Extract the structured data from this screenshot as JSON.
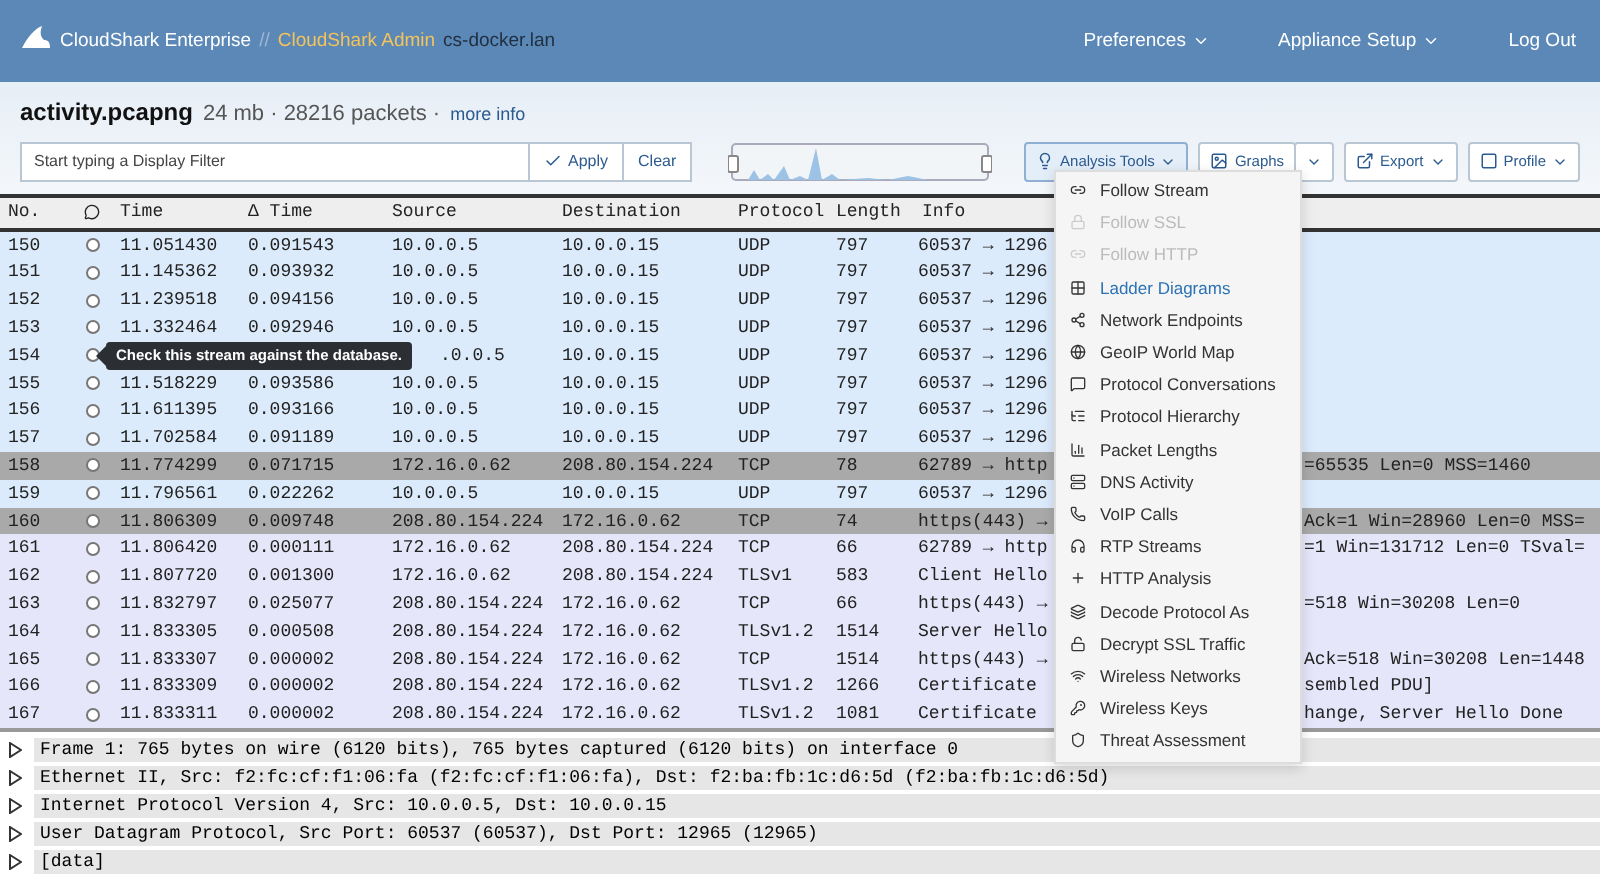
{
  "nav": {
    "brand": "CloudShark Enterprise",
    "separator": "//",
    "admin": "CloudShark Admin",
    "host": "cs-docker.lan",
    "links": [
      {
        "label": "Preferences",
        "dropdown": true
      },
      {
        "label": "Appliance Setup",
        "dropdown": true
      },
      {
        "label": "Log Out",
        "dropdown": false
      }
    ]
  },
  "file": {
    "name": "activity.pcapng",
    "meta": "24 mb · 28216 packets ·",
    "more": "more info"
  },
  "filter": {
    "placeholder": "Start typing a Display Filter",
    "apply": "Apply",
    "clear": "Clear"
  },
  "toolbar": [
    {
      "label": "Analysis Tools",
      "kind": "tools",
      "selected": true
    },
    {
      "label": "Graphs",
      "kind": "split",
      "selected": false
    },
    {
      "label": "Export",
      "kind": "export",
      "selected": false
    },
    {
      "label": "Profile",
      "kind": "profile",
      "selected": false
    }
  ],
  "table": {
    "columns": [
      "No.",
      "Time",
      "Δ Time",
      "Source",
      "Destination",
      "Protocol",
      "Length",
      "Info"
    ],
    "rows": [
      {
        "no": "150",
        "time": "11.051430",
        "delta": "0.091543",
        "source": "10.0.0.5",
        "destination": "10.0.0.15",
        "protocol": "UDP",
        "length": "797",
        "info": "60537 → 1296",
        "color": "#dcebfb"
      },
      {
        "no": "151",
        "time": "11.145362",
        "delta": "0.093932",
        "source": "10.0.0.5",
        "destination": "10.0.0.15",
        "protocol": "UDP",
        "length": "797",
        "info": "60537 → 1296",
        "color": "#dcebfb"
      },
      {
        "no": "152",
        "time": "11.239518",
        "delta": "0.094156",
        "source": "10.0.0.5",
        "destination": "10.0.0.15",
        "protocol": "UDP",
        "length": "797",
        "info": "60537 → 1296",
        "color": "#dcebfb"
      },
      {
        "no": "153",
        "time": "11.332464",
        "delta": "0.092946",
        "source": "10.0.0.5",
        "destination": "10.0.0.15",
        "protocol": "UDP",
        "length": "797",
        "info": "60537 → 1296",
        "color": "#dcebfb"
      },
      {
        "no": "154",
        "tooltip": "Check this stream against the database.",
        "source": ".0.0.5",
        "destination": "10.0.0.15",
        "protocol": "UDP",
        "length": "797",
        "info": "60537 → 1296",
        "color": "#dcebfb"
      },
      {
        "no": "155",
        "time": "11.518229",
        "delta": "0.093586",
        "source": "10.0.0.5",
        "destination": "10.0.0.15",
        "protocol": "UDP",
        "length": "797",
        "info": "60537 → 1296",
        "color": "#dcebfb"
      },
      {
        "no": "156",
        "time": "11.611395",
        "delta": "0.093166",
        "source": "10.0.0.5",
        "destination": "10.0.0.15",
        "protocol": "UDP",
        "length": "797",
        "info": "60537 → 1296",
        "color": "#dcebfb"
      },
      {
        "no": "157",
        "time": "11.702584",
        "delta": "0.091189",
        "source": "10.0.0.5",
        "destination": "10.0.0.15",
        "protocol": "UDP",
        "length": "797",
        "info": "60537 → 1296",
        "color": "#dcebfb"
      },
      {
        "no": "158",
        "time": "11.774299",
        "delta": "0.071715",
        "source": "172.16.0.62",
        "destination": "208.80.154.224",
        "protocol": "TCP",
        "length": "78",
        "info": "62789 → http",
        "info_right": "=65535 Len=0 MSS=1460",
        "color": "#a9a9a9"
      },
      {
        "no": "159",
        "time": "11.796561",
        "delta": "0.022262",
        "source": "10.0.0.5",
        "destination": "10.0.0.15",
        "protocol": "UDP",
        "length": "797",
        "info": "60537 → 1296",
        "color": "#dcebfb"
      },
      {
        "no": "160",
        "time": "11.806309",
        "delta": "0.009748",
        "source": "208.80.154.224",
        "destination": "172.16.0.62",
        "protocol": "TCP",
        "length": "74",
        "info": "https(443) →",
        "info_right": "Ack=1 Win=28960 Len=0 MSS=",
        "color": "#a9a9a9"
      },
      {
        "no": "161",
        "time": "11.806420",
        "delta": "0.000111",
        "source": "172.16.0.62",
        "destination": "208.80.154.224",
        "protocol": "TCP",
        "length": "66",
        "info": "62789 → http",
        "info_right": "=1 Win=131712 Len=0 TSval=",
        "color": "#e6e6fa"
      },
      {
        "no": "162",
        "time": "11.807720",
        "delta": "0.001300",
        "source": "172.16.0.62",
        "destination": "208.80.154.224",
        "protocol": "TLSv1",
        "length": "583",
        "info": "Client Hello",
        "color": "#e6e6fa"
      },
      {
        "no": "163",
        "time": "11.832797",
        "delta": "0.025077",
        "source": "208.80.154.224",
        "destination": "172.16.0.62",
        "protocol": "TCP",
        "length": "66",
        "info": "https(443) →",
        "info_right": "=518 Win=30208 Len=0",
        "color": "#e6e6fa"
      },
      {
        "no": "164",
        "time": "11.833305",
        "delta": "0.000508",
        "source": "208.80.154.224",
        "destination": "172.16.0.62",
        "protocol": "TLSv1.2",
        "length": "1514",
        "info": "Server Hello",
        "color": "#e6e6fa"
      },
      {
        "no": "165",
        "time": "11.833307",
        "delta": "0.000002",
        "source": "208.80.154.224",
        "destination": "172.16.0.62",
        "protocol": "TCP",
        "length": "1514",
        "info": "https(443) →",
        "info_right": "Ack=518 Win=30208 Len=1448",
        "color": "#e6e6fa"
      },
      {
        "no": "166",
        "time": "11.833309",
        "delta": "0.000002",
        "source": "208.80.154.224",
        "destination": "172.16.0.62",
        "protocol": "TLSv1.2",
        "length": "1266",
        "info": "Certificate",
        "info_right": "sembled PDU]",
        "color": "#e6e6fa"
      },
      {
        "no": "167",
        "time": "11.833311",
        "delta": "0.000002",
        "source": "208.80.154.224",
        "destination": "172.16.0.62",
        "protocol": "TLSv1.2",
        "length": "1081",
        "info": "Certificate",
        "info_right": "hange, Server Hello Done",
        "color": "#e6e6fa"
      }
    ]
  },
  "details": [
    {
      "text": "Frame 1: 765 bytes on wire (6120 bits), 765 bytes captured (6120 bits) on interface 0",
      "expanded": false
    },
    {
      "text": "Ethernet II, Src: f2:fc:cf:f1:06:fa (f2:fc:cf:f1:06:fa), Dst: f2:ba:fb:1c:d6:5d (f2:ba:fb:1c:d6:5d)",
      "expanded": false
    },
    {
      "text": "Internet Protocol Version 4, Src: 10.0.0.5, Dst: 10.0.0.15",
      "expanded": false
    },
    {
      "text": "User Datagram Protocol, Src Port: 60537 (60537), Dst Port: 12965 (12965)",
      "expanded": false
    },
    {
      "text": "[data]",
      "expanded": false
    }
  ],
  "menu": [
    {
      "label": "Follow Stream",
      "disabled": false,
      "selected": false
    },
    {
      "label": "Follow SSL",
      "disabled": true,
      "selected": false
    },
    {
      "label": "Follow HTTP",
      "disabled": true,
      "selected": false
    },
    {
      "label": "Ladder Diagrams",
      "disabled": false,
      "selected": true
    },
    {
      "label": "Network Endpoints",
      "disabled": false,
      "selected": false
    },
    {
      "label": "GeoIP World Map",
      "disabled": false,
      "selected": false
    },
    {
      "label": "Protocol Conversations",
      "disabled": false,
      "selected": false
    },
    {
      "label": "Protocol Hierarchy",
      "disabled": false,
      "selected": false
    },
    {
      "label": "Packet Lengths",
      "disabled": false,
      "selected": false
    },
    {
      "label": "DNS Activity",
      "disabled": false,
      "selected": false
    },
    {
      "label": "VoIP Calls",
      "disabled": false,
      "selected": false
    },
    {
      "label": "RTP Streams",
      "disabled": false,
      "selected": false
    },
    {
      "label": "HTTP Analysis",
      "disabled": false,
      "selected": false
    },
    {
      "label": "Decode Protocol As",
      "disabled": false,
      "selected": false
    },
    {
      "label": "Decrypt SSL Traffic",
      "disabled": false,
      "selected": false
    },
    {
      "label": "Wireless Networks",
      "disabled": false,
      "selected": false
    },
    {
      "label": "Wireless Keys",
      "disabled": false,
      "selected": false
    },
    {
      "label": "Threat Assessment",
      "disabled": false,
      "selected": false
    }
  ]
}
